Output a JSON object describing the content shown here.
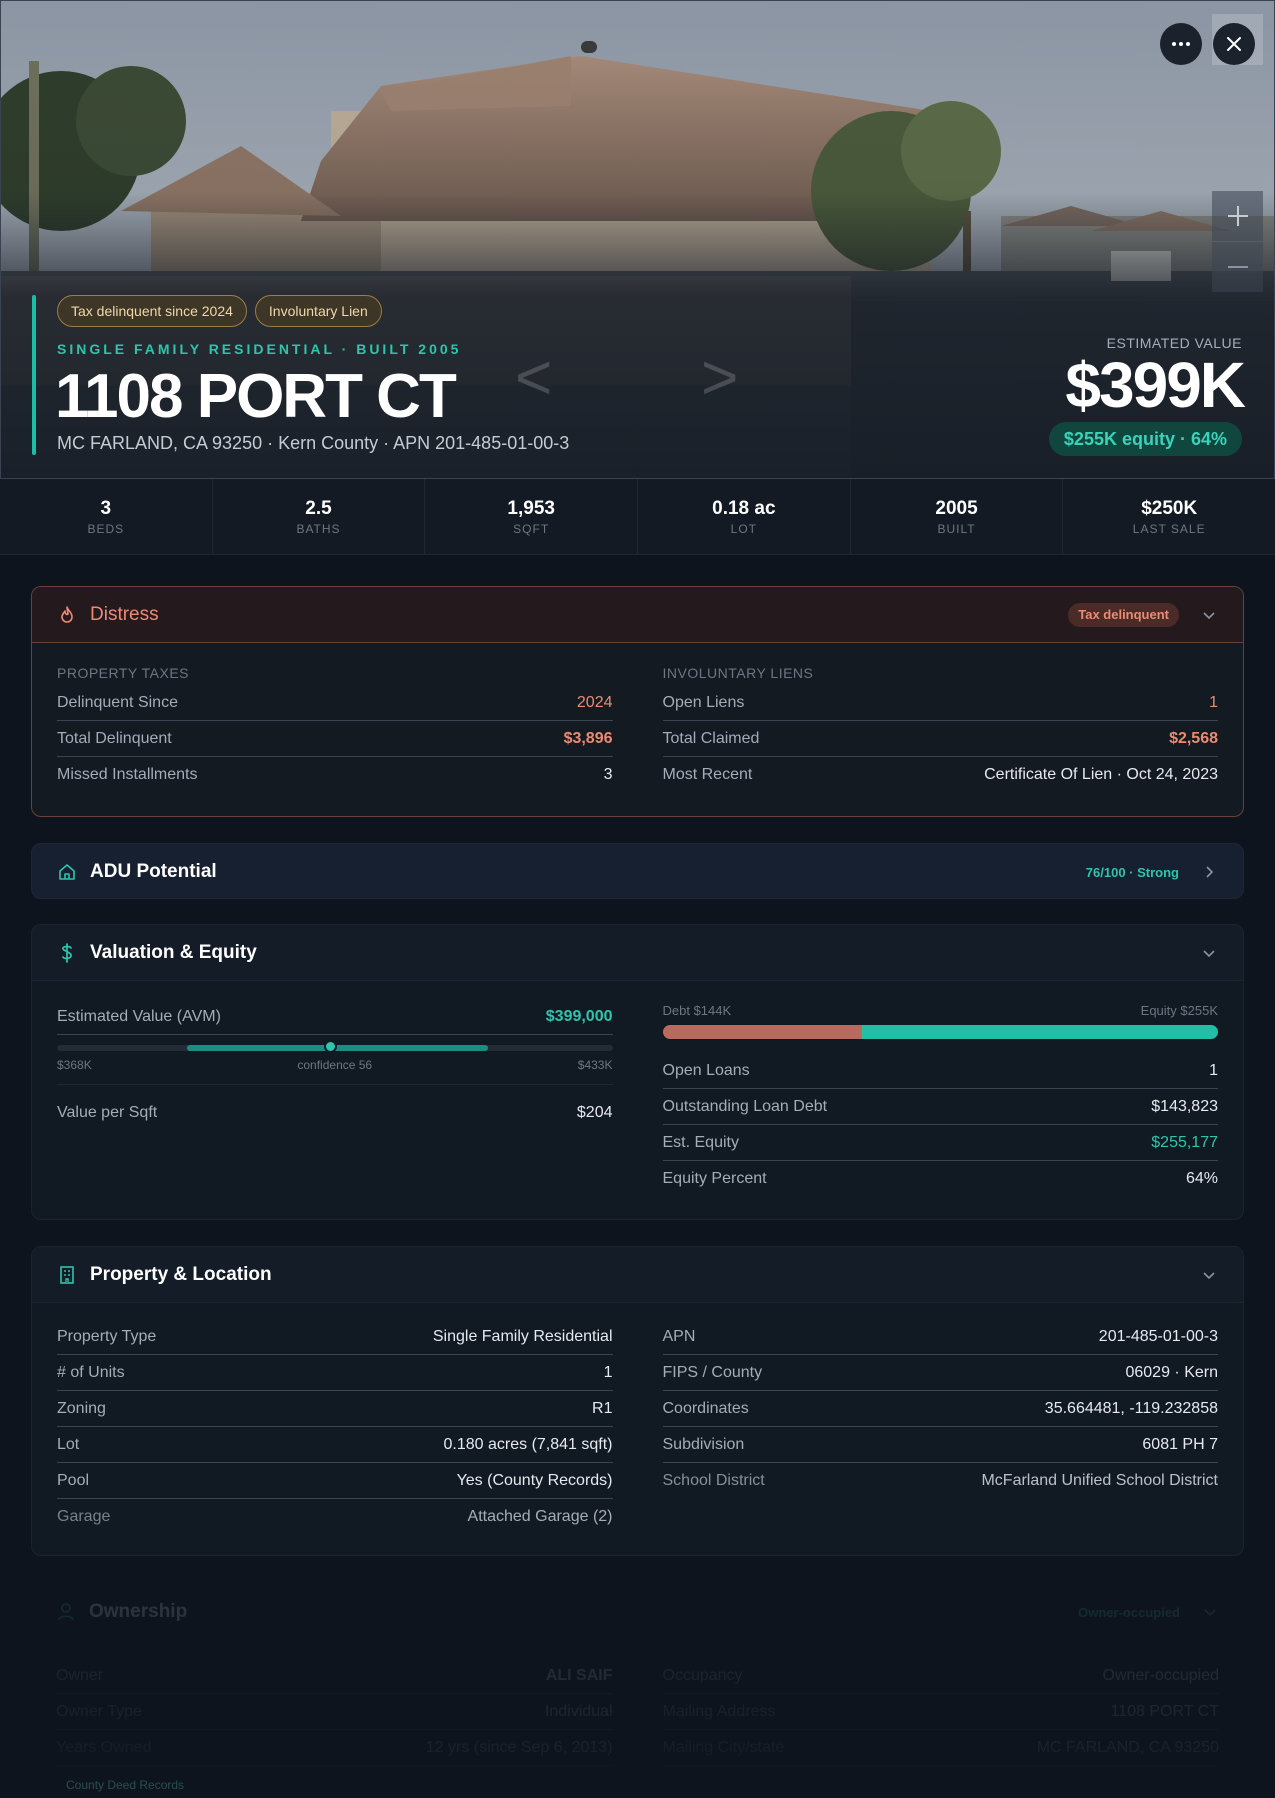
{
  "hero": {
    "badges": [
      "Tax delinquent since 2024",
      "Involuntary Lien"
    ],
    "subtitle": "SINGLE FAMILY RESIDENTIAL · BUILT 2005",
    "title": "1108 PORT CT",
    "address": "MC FARLAND, CA 93250 · Kern County · APN 201-485-01-00-3",
    "estimated_label": "ESTIMATED VALUE",
    "estimated_value": "$399K",
    "equity_pill": "$255K equity · 64%",
    "prev_glyph": "<",
    "next_glyph": ">"
  },
  "controls": {
    "more_icon": "more-horizontal-icon",
    "close_icon": "close-icon",
    "zoom_in_icon": "plus-icon",
    "zoom_out_icon": "minus-icon"
  },
  "stats": [
    {
      "value": "3",
      "label": "BEDS"
    },
    {
      "value": "2.5",
      "label": "BATHS"
    },
    {
      "value": "1,953",
      "label": "SQFT"
    },
    {
      "value": "0.18 ac",
      "label": "LOT"
    },
    {
      "value": "2005",
      "label": "BUILT"
    },
    {
      "value": "$250K",
      "label": "LAST SALE"
    }
  ],
  "distress": {
    "title": "Distress",
    "badge": "Tax delinquent",
    "taxes": {
      "label": "PROPERTY TAXES",
      "rows": [
        {
          "k": "Delinquent Since",
          "v": "2024"
        },
        {
          "k": "Total Delinquent",
          "v": "$3,896"
        },
        {
          "k": "Missed Installments",
          "v": "3"
        }
      ]
    },
    "liens": {
      "label": "INVOLUNTARY LIENS",
      "rows": [
        {
          "k": "Open Liens",
          "v": "1"
        },
        {
          "k": "Total Claimed",
          "v": "$2,568"
        },
        {
          "k": "Most Recent",
          "v": "Certificate Of Lien · Oct 24, 2023"
        }
      ]
    }
  },
  "adu": {
    "title": "ADU Potential",
    "score": "76/100 · Strong"
  },
  "valuation": {
    "title": "Valuation & Equity",
    "avm_label": "Estimated Value (AVM)",
    "avm_value": "$399,000",
    "range_low": "$368K",
    "range_high": "$433K",
    "confidence_text": "confidence 56",
    "confidence_range": {
      "low": 368000,
      "high": 433000,
      "estimate": 399000,
      "scale_min": 340000,
      "scale_max": 460000
    },
    "vps_label": "Value per Sqft",
    "vps_value": "$204",
    "debt_label": "Debt $144K",
    "equity_label": "Equity $255K",
    "debt_fraction": 0.36,
    "rows": [
      {
        "k": "Open Loans",
        "v": "1"
      },
      {
        "k": "Outstanding Loan Debt",
        "v": "$143,823"
      },
      {
        "k": "Est. Equity",
        "v": "$255,177"
      },
      {
        "k": "Equity Percent",
        "v": "64%"
      }
    ]
  },
  "property": {
    "title": "Property & Location",
    "left": [
      {
        "k": "Property Type",
        "v": "Single Family Residential"
      },
      {
        "k": "# of Units",
        "v": "1"
      },
      {
        "k": "Zoning",
        "v": "R1"
      },
      {
        "k": "Lot",
        "v": "0.180 acres (7,841 sqft)"
      },
      {
        "k": "Pool",
        "v": "Yes (County Records)"
      },
      {
        "k": "Garage",
        "v": "Attached Garage (2)"
      }
    ],
    "right": [
      {
        "k": "APN",
        "v": "201-485-01-00-3"
      },
      {
        "k": "FIPS / County",
        "v": "06029 · Kern"
      },
      {
        "k": "Coordinates",
        "v": "35.664481, -119.232858"
      },
      {
        "k": "Subdivision",
        "v": "6081 PH 7"
      },
      {
        "k": "School District",
        "v": "McFarland Unified School District"
      }
    ]
  },
  "ownership": {
    "title": "Ownership",
    "badge": "Owner-occupied",
    "left": [
      {
        "k": "Owner",
        "v": "ALI SAIF"
      },
      {
        "k": "Owner Type",
        "v": "Individual"
      },
      {
        "k": "Years Owned",
        "v": "12 yrs (since Sep 6, 2013)"
      }
    ],
    "right": [
      {
        "k": "Occupancy",
        "v": "Owner-occupied"
      },
      {
        "k": "Mailing Address",
        "v": "1108 PORT CT"
      },
      {
        "k": "Mailing City/state",
        "v": "MC FARLAND, CA 93250"
      }
    ],
    "footer": "County Deed Records"
  },
  "colors": {
    "accent": "#1fbca5",
    "distress": "#ec8a73",
    "debt": "#b96a5e",
    "equity": "#22bfa6"
  }
}
